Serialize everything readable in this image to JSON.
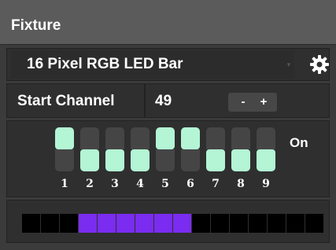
{
  "header": {
    "title": "Fixture"
  },
  "fixture": {
    "selected": "16 Pixel RGB LED Bar",
    "caret_glyph": "▾",
    "settings_icon": "gear-icon"
  },
  "start_channel": {
    "label": "Start Channel",
    "value": "49",
    "decrement_label": "-",
    "increment_label": "+"
  },
  "toggles": {
    "state_label": "On",
    "on_color": "#b3f5d5",
    "items": [
      {
        "number": "1",
        "state": "up"
      },
      {
        "number": "2",
        "state": "down"
      },
      {
        "number": "3",
        "state": "down"
      },
      {
        "number": "4",
        "state": "down"
      },
      {
        "number": "5",
        "state": "up"
      },
      {
        "number": "6",
        "state": "up"
      },
      {
        "number": "7",
        "state": "down"
      },
      {
        "number": "8",
        "state": "down"
      },
      {
        "number": "9",
        "state": "down"
      }
    ]
  },
  "pixel_preview": {
    "on_color": "#7a2cf0",
    "off_color": "#000000",
    "pixels": [
      false,
      false,
      false,
      true,
      true,
      true,
      true,
      true,
      true,
      false,
      false,
      false,
      false,
      false,
      false,
      false
    ]
  }
}
